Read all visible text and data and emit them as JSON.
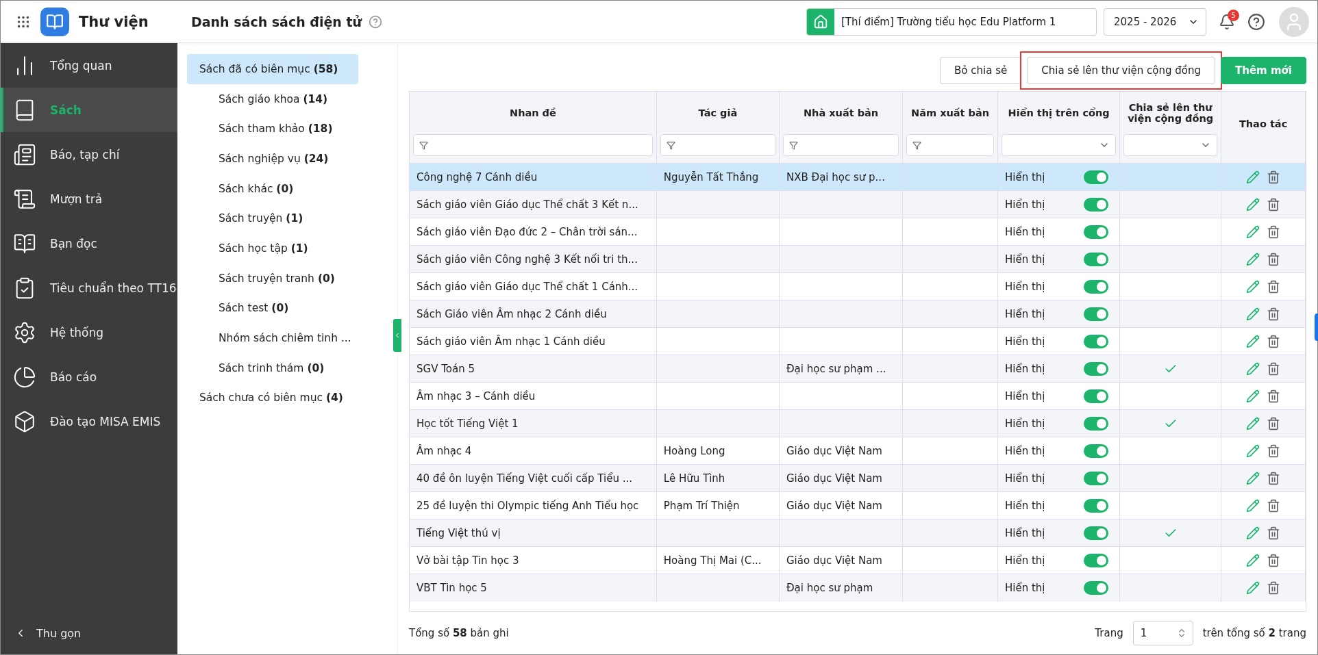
{
  "app": {
    "name": "Thư viện"
  },
  "header": {
    "title": "Danh sách sách điện tử",
    "school": "[Thí điểm] Trường tiểu học Edu Platform 1",
    "year": "2025 - 2026",
    "notifications": "5"
  },
  "sidebar": {
    "items": [
      {
        "label": "Tổng quan",
        "selected": false
      },
      {
        "label": "Sách",
        "selected": true
      },
      {
        "label": "Báo, tạp chí",
        "selected": false
      },
      {
        "label": "Mượn trả",
        "selected": false
      },
      {
        "label": "Bạn đọc",
        "selected": false
      },
      {
        "label": "Tiêu chuẩn theo TT16",
        "selected": false
      },
      {
        "label": "Hệ thống",
        "selected": false
      },
      {
        "label": "Báo cáo",
        "selected": false
      },
      {
        "label": "Đào tạo MISA EMIS",
        "selected": false
      }
    ],
    "collapse": "Thu gọn"
  },
  "tree": [
    {
      "label": "Sách đã có biên mục **(58)**",
      "selected": true,
      "children": [
        {
          "label": "Sách giáo khoa **(14)**",
          "selected": false
        },
        {
          "label": "Sách tham khảo **(18)**",
          "selected": false
        },
        {
          "label": "Sách nghiệp vụ **(24)**",
          "selected": false
        },
        {
          "label": "Sách khác **(0)**",
          "selected": false
        },
        {
          "label": "Sách truyện **(1)**",
          "selected": false
        },
        {
          "label": "Sách học tập **(1)**",
          "selected": false
        },
        {
          "label": "Sách truyện tranh **(0)**",
          "selected": false
        },
        {
          "label": "Sách test **(0)**",
          "selected": false
        },
        {
          "label": "Nhóm sách chiêm tinh ...",
          "selected": false
        },
        {
          "label": "Sách trinh thám **(0)**",
          "selected": false
        }
      ]
    },
    {
      "label": "Sách chưa có biên mục **(4)**",
      "selected": false
    }
  ],
  "toolbar": {
    "buttons": [
      {
        "label": "Bỏ chia sẻ",
        "kind": "outline",
        "highlighted": false
      },
      {
        "label": "Chia sẻ lên thư viện cộng đồng",
        "kind": "outline",
        "highlighted": true
      },
      {
        "label": "Thêm mới",
        "kind": "primary",
        "highlighted": false
      }
    ]
  },
  "table": {
    "columns": [
      {
        "label": "Nhan đề",
        "kind": "text"
      },
      {
        "label": "Tác giả",
        "kind": "text"
      },
      {
        "label": "Nhà xuất bản",
        "kind": "text"
      },
      {
        "label": "Năm xuất bản",
        "kind": "text"
      },
      {
        "label": "Hiển thị trên cổng",
        "kind": "select"
      },
      {
        "label": "Chia sẻ lên thư viện cộng đồng",
        "kind": "select"
      },
      {
        "label": "Thao tác",
        "kind": "plain"
      }
    ],
    "rows": [
      {
        "title": "Công nghệ 7 Cánh diều",
        "author": "Nguyễn Tất Thắng",
        "publisher": "NXB Đại học sư p...",
        "display": "Hiển thị",
        "on": true,
        "shared": false,
        "selected": true
      },
      {
        "title": "Sách giáo viên Giáo dục Thể chất 3 Kết n...",
        "display": "Hiển thị",
        "on": true,
        "shared": false,
        "selected": false
      },
      {
        "title": "Sách giáo viên Đạo đức 2 – Chân trời sán...",
        "display": "Hiển thị",
        "on": true,
        "shared": false,
        "selected": false
      },
      {
        "title": "Sách giáo viên Công nghệ 3 Kết nối tri th...",
        "display": "Hiển thị",
        "on": true,
        "shared": false,
        "selected": false
      },
      {
        "title": "Sách giáo viên Giáo dục Thể chất 1 Cánh...",
        "display": "Hiển thị",
        "on": true,
        "shared": false,
        "selected": false
      },
      {
        "title": "Sách Giáo viên Âm nhạc 2 Cánh diều",
        "display": "Hiển thị",
        "on": true,
        "shared": false,
        "selected": false
      },
      {
        "title": "Sách giáo viên Âm nhạc 1 Cánh diều",
        "display": "Hiển thị",
        "on": true,
        "shared": false,
        "selected": false
      },
      {
        "title": "SGV Toán 5",
        "publisher": "Đại học sư phạm ...",
        "display": "Hiển thị",
        "on": true,
        "shared": true,
        "selected": false
      },
      {
        "title": "Âm nhạc 3 – Cánh diều",
        "display": "Hiển thị",
        "on": true,
        "shared": false,
        "selected": false
      },
      {
        "title": "Học tốt Tiếng Việt 1",
        "display": "Hiển thị",
        "on": true,
        "shared": true,
        "selected": false
      },
      {
        "title": "Âm nhạc 4",
        "author": "Hoàng Long",
        "publisher": "Giáo dục Việt Nam",
        "display": "Hiển thị",
        "on": true,
        "shared": false,
        "selected": false
      },
      {
        "title": "40 đề ôn luyện Tiếng Việt cuối cấp Tiểu ...",
        "author": "Lê Hữu Tình",
        "publisher": "Giáo dục Việt Nam",
        "display": "Hiển thị",
        "on": true,
        "shared": false,
        "selected": false
      },
      {
        "title": "25 đề luyện thi Olympic tiếng Anh Tiểu học",
        "author": "Phạm Trí Thiện",
        "publisher": "Giáo dục Việt Nam",
        "display": "Hiển thị",
        "on": true,
        "shared": false,
        "selected": false
      },
      {
        "title": "Tiếng Việt thú vị",
        "display": "Hiển thị",
        "on": true,
        "shared": true,
        "selected": false
      },
      {
        "title": "Vở bài tập Tin học 3",
        "author": "Hoàng Thị Mai (C...",
        "publisher": "Giáo dục Việt Nam",
        "display": "Hiển thị",
        "on": true,
        "shared": false,
        "selected": false
      },
      {
        "title": "VBT Tin học 5",
        "publisher": "Đại học sư phạm",
        "display": "Hiển thị",
        "on": true,
        "shared": false,
        "selected": false
      }
    ]
  },
  "footer": {
    "total": "Tổng số **58** bản ghi",
    "page_label": "Trang",
    "page": "1",
    "pages": "trên tổng số **2** trang"
  }
}
